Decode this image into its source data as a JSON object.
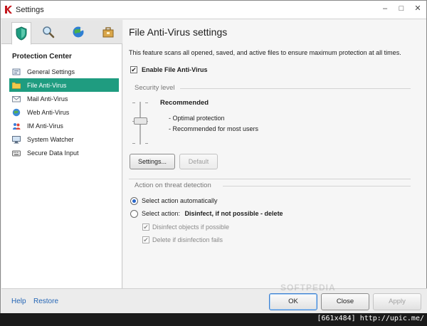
{
  "window": {
    "title": "Settings",
    "controls": {
      "minimize": "–",
      "maximize": "□",
      "close": "✕"
    }
  },
  "sidebar": {
    "section_title": "Protection Center",
    "items": [
      {
        "label": "General Settings",
        "icon": "general-settings-icon"
      },
      {
        "label": "File Anti-Virus",
        "icon": "folder-icon",
        "active": true
      },
      {
        "label": "Mail Anti-Virus",
        "icon": "mail-icon"
      },
      {
        "label": "Web Anti-Virus",
        "icon": "globe-icon"
      },
      {
        "label": "IM Anti-Virus",
        "icon": "chat-icon"
      },
      {
        "label": "System Watcher",
        "icon": "monitor-icon"
      },
      {
        "label": "Secure Data Input",
        "icon": "keyboard-icon"
      }
    ]
  },
  "main": {
    "title": "File Anti-Virus settings",
    "description": "This feature scans all opened, saved, and active files to ensure maximum protection at all times.",
    "enable_label": "Enable File Anti-Virus",
    "enable_checked": "✔",
    "security_level": {
      "group_label": "Security level",
      "level_name": "Recommended",
      "lines": [
        "- Optimal protection",
        "- Recommended for most users"
      ],
      "settings_button": "Settings...",
      "default_button": "Default"
    },
    "threat": {
      "group_label": "Action on threat detection",
      "option_auto": "Select action automatically",
      "option_select": "Select action:",
      "option_select_value": "Disinfect, if not possible - delete",
      "sub_disinfect": "Disinfect objects if possible",
      "sub_delete": "Delete if disinfection fails",
      "sub_checked": "✔"
    }
  },
  "footer": {
    "help": "Help",
    "restore": "Restore",
    "ok": "OK",
    "close": "Close",
    "apply": "Apply"
  },
  "watermark": "SOFTPEDIA",
  "image_footer": "[661x484] http://upic.me/",
  "colors": {
    "accent": "#1f9c80",
    "link": "#2566b5"
  }
}
